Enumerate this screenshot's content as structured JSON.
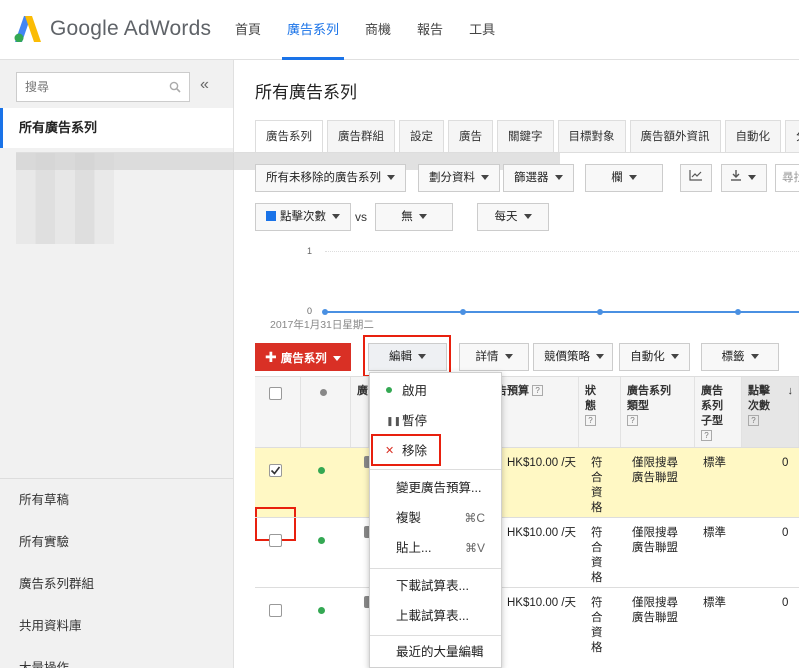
{
  "header": {
    "logo_text": "Google AdWords",
    "nav": [
      "首頁",
      "廣告系列",
      "商機",
      "報告",
      "工具"
    ]
  },
  "sidebar": {
    "search_placeholder": "搜尋",
    "collapse_glyph": "«",
    "selected_item": "所有廣告系列",
    "bottom_items": [
      "所有草稿",
      "所有實驗",
      "廣告系列群組",
      "共用資料庫",
      "大量操作"
    ]
  },
  "main": {
    "title": "所有廣告系列",
    "tabs": [
      "廣告系列",
      "廣告群組",
      "設定",
      "廣告",
      "關鍵字",
      "目標對象",
      "廣告額外資訊",
      "自動化",
      "分"
    ]
  },
  "toolbar": {
    "filter": "所有未移除的廣告系列",
    "segment": "劃分資料",
    "filters": "篩選器",
    "columns": "欄",
    "search": "尋找"
  },
  "chart_controls": {
    "metric": "點擊次數",
    "vs": "vs",
    "compare": "無",
    "period": "每天"
  },
  "chart": {
    "tick_top": "1",
    "tick_bottom": "0",
    "date": "2017年1月31日星期二"
  },
  "actions": {
    "add": "廣告系列",
    "edit": "編輯",
    "details": "詳情",
    "bidding": "競價策略",
    "automate": "自動化",
    "labels": "標籤"
  },
  "table": {
    "headers": {
      "campaign": "廣",
      "budget": "廣告預算",
      "status": "狀態",
      "type": "廣告系列類型",
      "subtype": "廣告系列子型",
      "clicks": "點擊次數",
      "sort_arrow": "↓"
    },
    "rows": [
      {
        "budget": "HK$10.00 /天",
        "status": "符合資格",
        "type": "僅限搜尋廣告聯盟",
        "subtype": "標準",
        "clicks": "0",
        "checked": true
      },
      {
        "budget": "HK$10.00 /天",
        "status": "符合資格",
        "type": "僅限搜尋廣告聯盟",
        "subtype": "標準",
        "clicks": "0",
        "checked": false
      },
      {
        "budget": "HK$10.00 /天",
        "status": "符合資格",
        "type": "僅限搜尋廣告聯盟",
        "subtype": "標準",
        "clicks": "0",
        "checked": false
      }
    ]
  },
  "edit_menu": {
    "enable": "啟用",
    "pause": "暫停",
    "remove": "移除",
    "change_budget": "變更廣告預算...",
    "copy": "複製",
    "copy_shortcut": "⌘C",
    "paste": "貼上...",
    "paste_shortcut": "⌘V",
    "download_spreadsheet": "下載試算表...",
    "upload_spreadsheet": "上載試算表...",
    "recent_bulk_edits": "最近的大量編輯"
  },
  "colors": {
    "accent": "#1a73e8",
    "add_button": "#d93025",
    "highlight_box": "#e8200e",
    "selected_row": "#fff8c4",
    "status_green": "#34a853"
  }
}
